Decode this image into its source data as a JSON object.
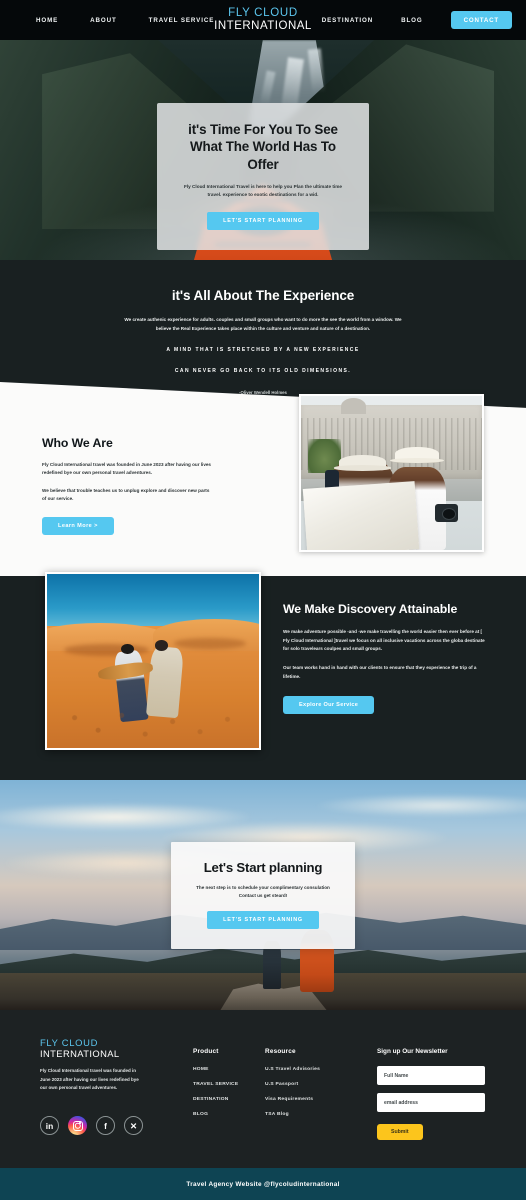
{
  "nav": {
    "links_left": [
      {
        "label": "HOME"
      },
      {
        "label": "ABOUT"
      },
      {
        "label": "TRAVEL SERVICE"
      }
    ],
    "links_right": [
      {
        "label": "DESTINATION"
      },
      {
        "label": "BLOG"
      }
    ],
    "logo_line1": "FLY CLOUD",
    "logo_line2": "INTERNATIONAL",
    "contact_label": "CONTACT"
  },
  "hero": {
    "heading": "it's Time For You To See What The World Has To Offer",
    "paragraph": "Fly Cloud International Travel is here to help you Plan the ultimate time travel. experience to exotic destinations for a wid.",
    "button_label": "LET'S START PLANNING",
    "image_alt": "kayak-on-fjord-photo"
  },
  "experience": {
    "heading": "it's All About The Experience",
    "paragraph": "We create authenic experience for adults. couples and small groups who want to do more the see the world from a window. We believe the Real Experience takes place within the culture and venture and nature of a destination.",
    "quote_line1": "A MIND THAT IS STRETCHED BY A NEW EXPERIENCE",
    "quote_line2": "CAN NEVER GO BACK TO ITS OLD DIMENSIONS.",
    "citation": "-Oliver Wendell Holmes"
  },
  "who_we_are": {
    "heading": "Who We Are",
    "paragraph1": "Fly Cloud International travel was founded in June 2023 after having our lives redefined bye our own personal travel adventures.",
    "paragraph2": "We believe that trouble teaches us to unplug explore and discover new parts of  our service.",
    "button_label": "Learn More >",
    "image_alt": "couple-with-map-city-photo"
  },
  "discovery": {
    "heading": "We Make Discovery Attainable",
    "paragraph1": "We make adventure possible -and -we make travelling the world easier then ever before at [ Fly Cloud International ]travel we focus on all inclusive vacations across the globa destinate for solo travelears coulpes and small groups.",
    "paragraph2": "Our team works hand in hand with our clients to ensure that they experience the trip of a lifetime.",
    "button_label": "Explore Our Service",
    "image_alt": "couple-running-desert-dunes-photo"
  },
  "cta": {
    "heading": "Let's Start planning",
    "paragraph": "The next step is to schedule your complimentary consulation Contact us get steard!",
    "button_label": "LET'S START PLANNING",
    "image_alt": "hikers-on-mountain-summit-photo"
  },
  "footer": {
    "logo_line1": "FLY CLOUD",
    "logo_line2": "INTERNATIONAL",
    "about": "Fly Cloud International travel was founded in June 2023 after having our lives redefined bye our own personal travel adventures.",
    "socials": [
      {
        "name": "linkedin-icon",
        "glyph": "in"
      },
      {
        "name": "instagram-icon",
        "glyph": ""
      },
      {
        "name": "facebook-icon",
        "glyph": "f"
      },
      {
        "name": "x-twitter-icon",
        "glyph": "✕"
      }
    ],
    "product": {
      "heading": "Product",
      "items": [
        {
          "label": "HOME"
        },
        {
          "label": "TRAVEL SERVICE"
        },
        {
          "label": "DESTINATION"
        },
        {
          "label": "BLOG"
        }
      ]
    },
    "resource": {
      "heading": "Resource",
      "items": [
        {
          "label": "U.S Travel Advisories"
        },
        {
          "label": "U.S Passport"
        },
        {
          "label": "Visa Requirements"
        },
        {
          "label": "TSA Blog"
        }
      ]
    },
    "newsletter": {
      "heading": "Sign up Our Newsletter",
      "name_placeholder": "Full Name",
      "email_placeholder": "email address",
      "submit_label": "Submit"
    }
  },
  "bottom_bar": {
    "text": "Travel Agency Website @flycoludinternational"
  },
  "colors": {
    "accent_blue": "#55c8f0",
    "logo_blue": "#5cc6ee",
    "dark_section": "#192021",
    "footer_bg": "#1d2223",
    "bottom_bar": "#0e4453",
    "submit_yellow": "#fcc51c"
  }
}
